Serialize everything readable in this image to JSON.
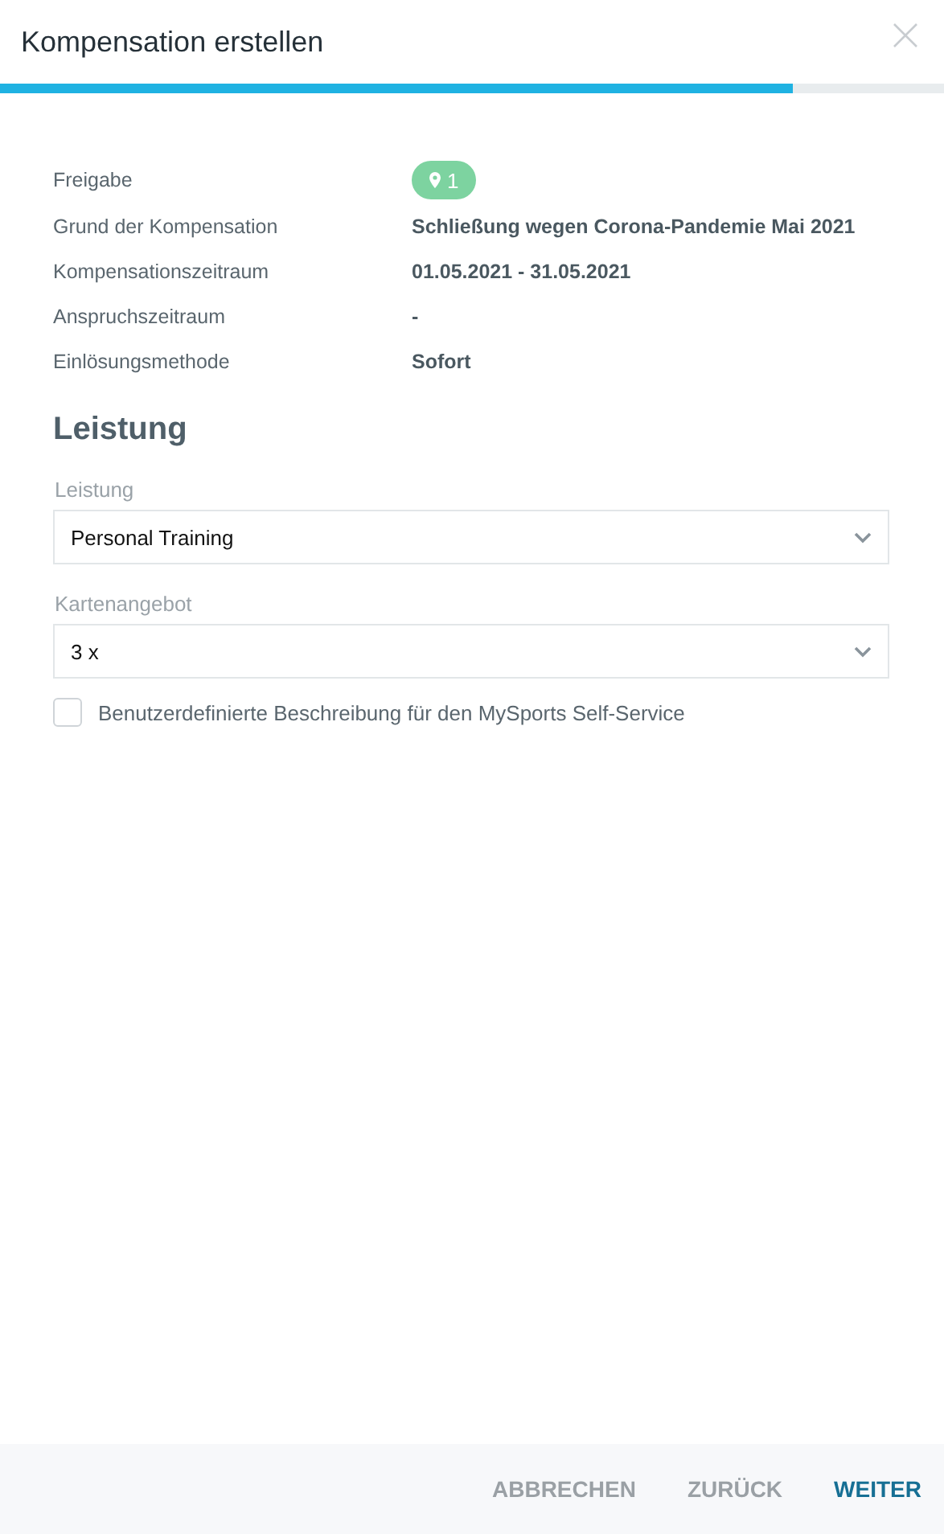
{
  "dialog": {
    "title": "Kompensation erstellen",
    "progress": {
      "level": 0.84
    }
  },
  "details": [
    {
      "label": "Freigabe",
      "kind": "badge",
      "value": "1"
    },
    {
      "label": "Grund der Kompensation",
      "kind": "text",
      "value": "Schließung wegen Corona-Pandemie Mai 2021"
    },
    {
      "label": "Kompensationszeitraum",
      "kind": "text",
      "value": "01.05.2021 - 31.05.2021"
    },
    {
      "label": "Anspruchszeitraum",
      "kind": "text",
      "value": "-"
    },
    {
      "label": "Einlösungsmethode",
      "kind": "text",
      "value": "Sofort"
    }
  ],
  "section": {
    "heading": "Leistung",
    "fields": [
      {
        "label": "Leistung",
        "value": "Personal Training"
      },
      {
        "label": "Kartenangebot",
        "value": "3 x"
      }
    ],
    "checkbox": {
      "label": "Benutzerdefinierte Beschreibung für den MySports Self-Service",
      "checked": false
    }
  },
  "footer": {
    "buttons": [
      {
        "label": "ABBRECHEN",
        "kind": "secondary"
      },
      {
        "label": "ZURÜCK",
        "kind": "secondary"
      },
      {
        "label": "WEITER",
        "kind": "primary"
      }
    ]
  }
}
